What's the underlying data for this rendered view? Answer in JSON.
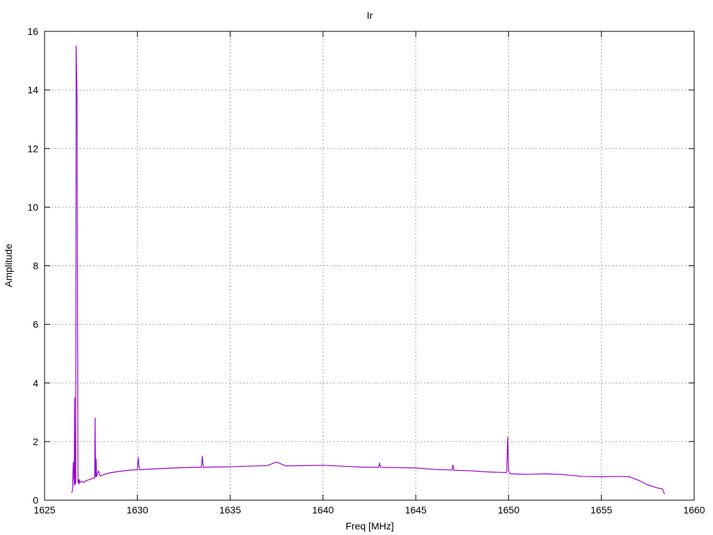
{
  "chart_data": {
    "type": "line",
    "title": "Ir",
    "xlabel": "Freq [MHz]",
    "ylabel": "Amplitude",
    "xlim": [
      1625,
      1660
    ],
    "ylim": [
      0,
      16
    ],
    "xticks": [
      1625,
      1630,
      1635,
      1640,
      1645,
      1650,
      1655,
      1660
    ],
    "yticks": [
      0,
      2,
      4,
      6,
      8,
      10,
      12,
      14,
      16
    ],
    "grid": true,
    "colors": {
      "line": "#9400d3",
      "grid": "#a0a0a0",
      "axis": "#000000"
    },
    "series": [
      {
        "name": "",
        "x": [
          1626.45,
          1626.5,
          1626.55,
          1626.6,
          1626.62,
          1626.65,
          1626.68,
          1626.7,
          1626.75,
          1626.8,
          1626.83,
          1626.85,
          1626.88,
          1626.9,
          1626.95,
          1627.0,
          1627.1,
          1627.2,
          1627.3,
          1627.5,
          1627.7,
          1627.72,
          1627.75,
          1627.78,
          1627.8,
          1627.9,
          1628.0,
          1628.2,
          1628.5,
          1629.0,
          1629.5,
          1630.0,
          1630.05,
          1630.1,
          1631.0,
          1632.0,
          1633.0,
          1633.45,
          1633.5,
          1633.55,
          1634.0,
          1635.0,
          1636.0,
          1637.0,
          1637.5,
          1638.0,
          1639.0,
          1640.0,
          1641.0,
          1642.0,
          1643.0,
          1643.05,
          1643.1,
          1644.0,
          1645.0,
          1646.0,
          1646.95,
          1647.0,
          1647.05,
          1648.0,
          1649.0,
          1649.9,
          1649.95,
          1650.0,
          1650.05,
          1650.1,
          1651.0,
          1652.0,
          1653.0,
          1654.0,
          1655.0,
          1656.0,
          1656.5,
          1657.0,
          1657.5,
          1658.0,
          1658.3,
          1658.4
        ],
        "y": [
          0.25,
          0.3,
          1.3,
          0.5,
          3.5,
          0.55,
          0.6,
          15.5,
          13.8,
          0.6,
          0.7,
          0.55,
          0.7,
          0.6,
          0.62,
          0.65,
          0.6,
          0.65,
          0.68,
          0.72,
          0.76,
          2.8,
          0.8,
          1.4,
          0.8,
          1.0,
          0.82,
          0.88,
          0.93,
          0.98,
          1.02,
          1.04,
          1.45,
          1.04,
          1.07,
          1.1,
          1.12,
          1.12,
          1.5,
          1.12,
          1.13,
          1.14,
          1.16,
          1.18,
          1.3,
          1.17,
          1.18,
          1.19,
          1.16,
          1.13,
          1.12,
          1.27,
          1.12,
          1.11,
          1.1,
          1.05,
          1.03,
          1.2,
          1.02,
          1.0,
          0.96,
          0.94,
          2.15,
          1.0,
          0.95,
          0.9,
          0.88,
          0.9,
          0.87,
          0.81,
          0.8,
          0.81,
          0.8,
          0.68,
          0.52,
          0.42,
          0.38,
          0.2
        ]
      }
    ]
  }
}
